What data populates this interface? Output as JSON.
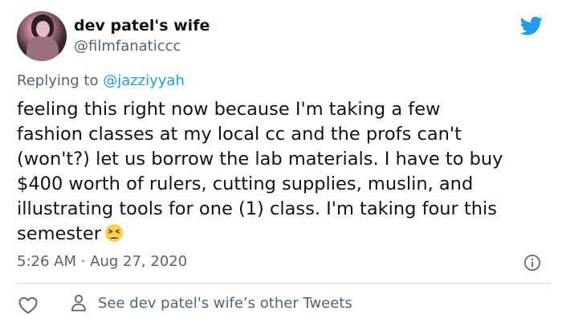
{
  "author": {
    "display_name": "dev patel's wife",
    "handle": "@filmfanaticcc"
  },
  "reply": {
    "prefix": "Replying to ",
    "mention": "@jazziyyah"
  },
  "tweet": {
    "lines": [
      "feeling this right now because I'm taking a few",
      "fashion classes at my local cc and the profs can't",
      "(won't?) let us borrow the lab materials. I have to buy",
      "$400 worth of rulers, cutting supplies, muslin, and",
      "illustrating tools for one (1) class. I'm taking four this",
      "semester"
    ],
    "emoji": "tired-face-emoji"
  },
  "meta": {
    "timestamp": "5:26 AM · Aug 27, 2020"
  },
  "actions": {
    "profile_link": "See dev patel's wife’s other Tweets"
  },
  "icons": {
    "brand": "twitter-bird-icon",
    "info": "info-icon",
    "like": "heart-icon",
    "profile": "person-icon"
  },
  "colors": {
    "brand_blue": "#1d9bf0",
    "secondary_text": "#536471",
    "primary_text": "#0f1419",
    "divider": "#cfd9de"
  }
}
